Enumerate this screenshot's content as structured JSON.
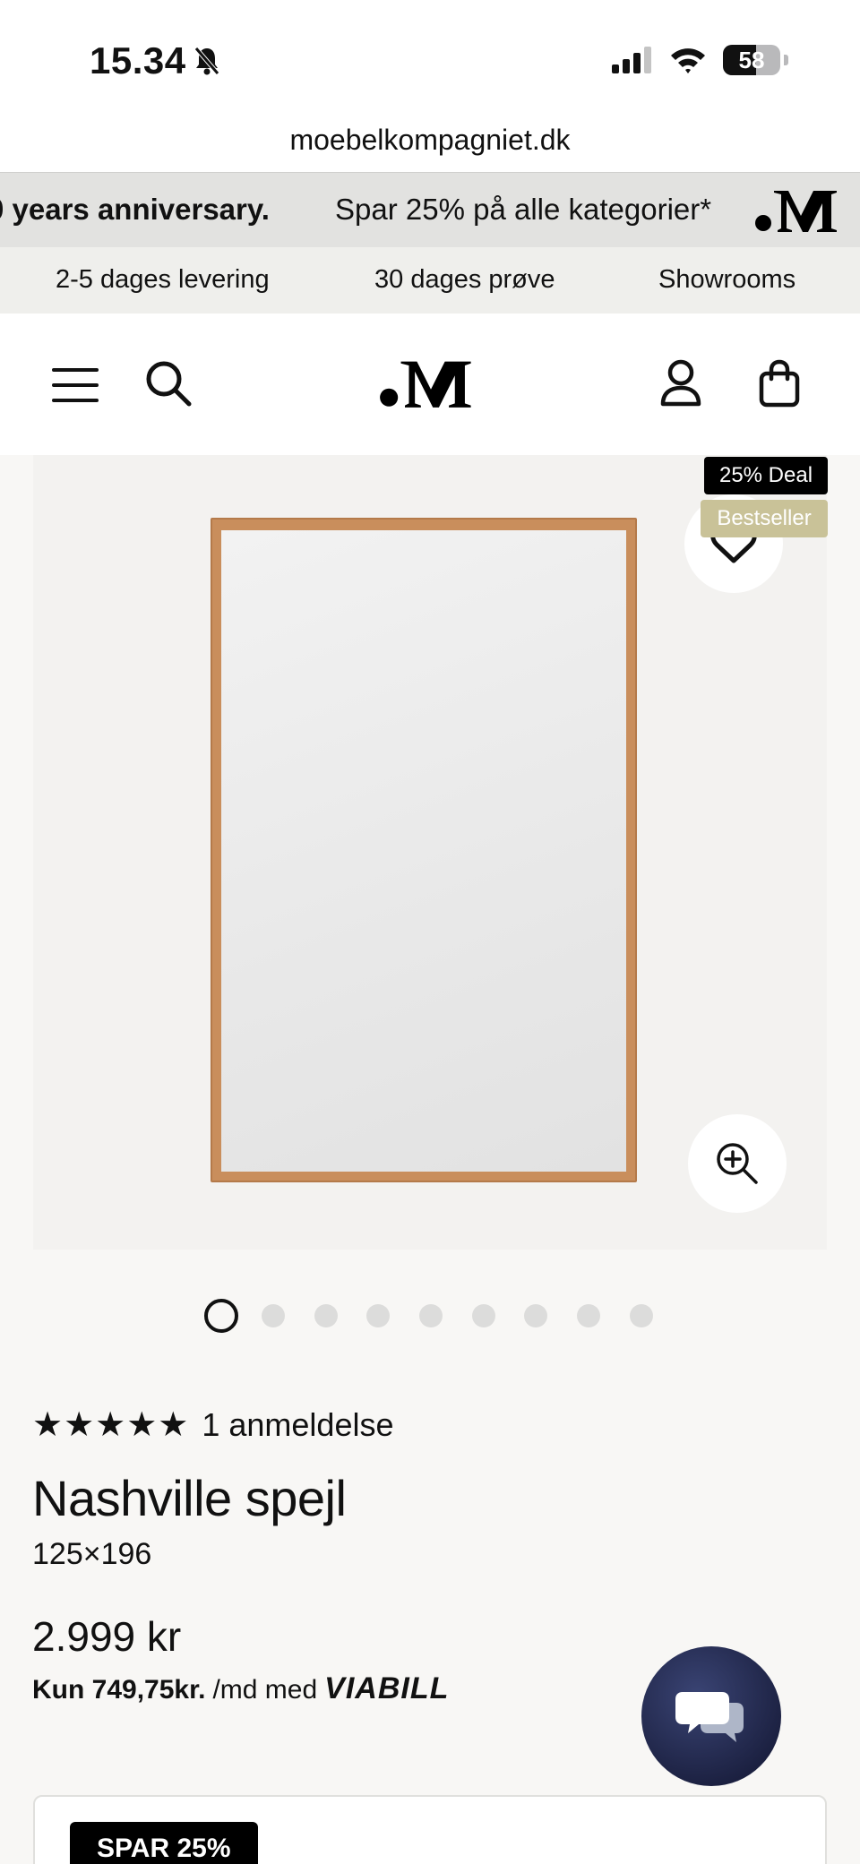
{
  "status_bar": {
    "time": "15.34",
    "battery": "58",
    "battery_fraction": 0.58
  },
  "browser": {
    "url": "moebelkompagniet.dk"
  },
  "promo_banner": {
    "left_text": "0 years anniversary.",
    "middle_text": "Spar 25% på alle kategorier*"
  },
  "usp_bar": {
    "items": [
      "2-5 dages levering",
      "30 dages prøve",
      "Showrooms"
    ]
  },
  "header": {
    "logo_icon": "moebelkompagniet-logo",
    "menu_icon": "hamburger-icon",
    "search_icon": "search-icon",
    "account_icon": "user-icon",
    "cart_icon": "shopping-bag-icon"
  },
  "gallery": {
    "badges": [
      "25% Deal",
      "Bestseller"
    ],
    "badge_colors": {
      "deal": "#000000",
      "bestseller": "#c9c298"
    },
    "image_count": 9,
    "active_index": 0
  },
  "product": {
    "stars": "★★★★★",
    "rating_value": 5,
    "review_count": "1 anmeldelse",
    "title": "Nashville spejl",
    "variant": "125×196",
    "price": "2.999 kr",
    "installment_amount": "Kun 749,75kr.",
    "installment_suffix": "/md med",
    "installment_provider": "VIABILL"
  },
  "offer_card": {
    "tag": "SPAR 25%"
  },
  "chat": {
    "icon": "chat-bubbles-icon",
    "color": "#222849"
  }
}
